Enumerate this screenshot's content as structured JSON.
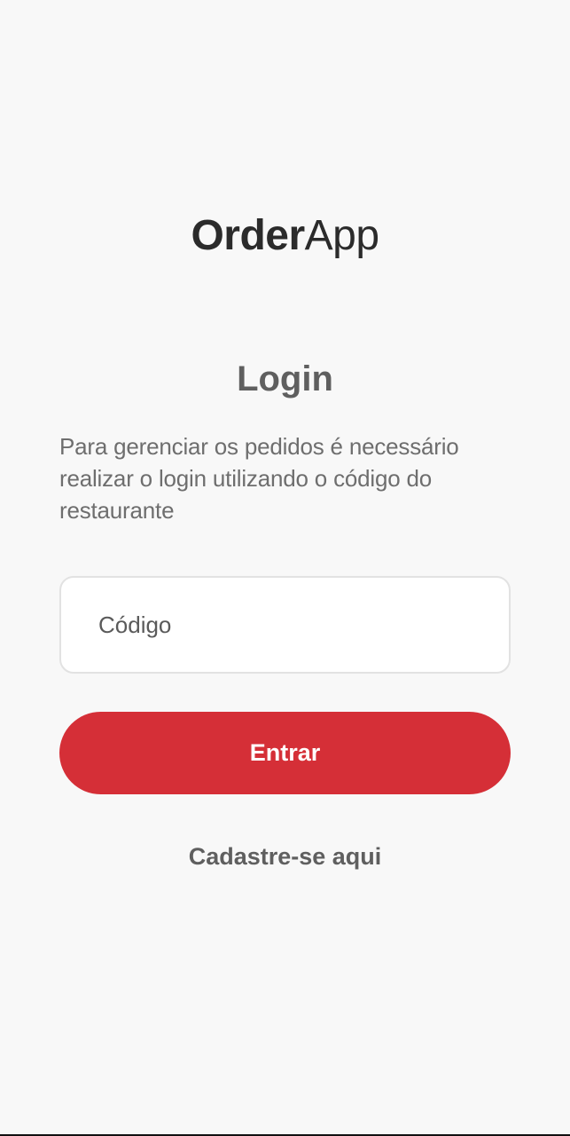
{
  "app": {
    "logo_bold": "Order",
    "logo_light": "App"
  },
  "login": {
    "title": "Login",
    "description": "Para gerenciar os pedidos é necessário realizar o login utilizando o código do restaurante",
    "code_placeholder": "Código",
    "code_value": "",
    "submit_label": "Entrar",
    "signup_label": "Cadastre-se aqui"
  },
  "colors": {
    "background": "#f8f8f8",
    "primary": "#d52f37",
    "text_dark": "#2b2b2b",
    "text_muted": "#6e6e6e"
  }
}
